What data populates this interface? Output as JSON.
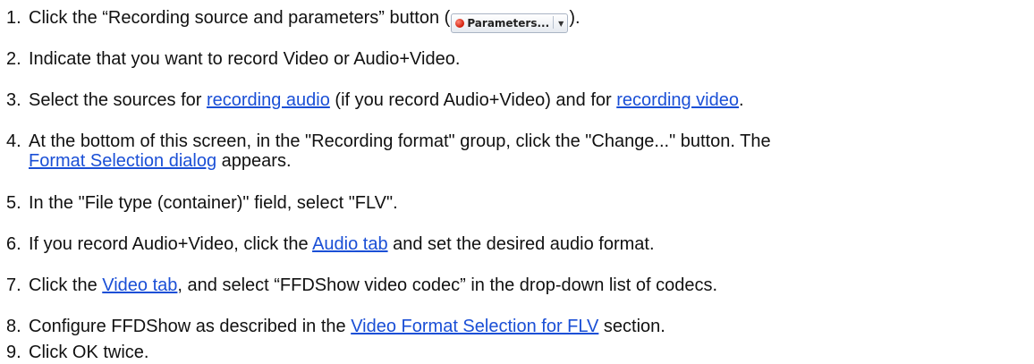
{
  "steps": [
    {
      "num": "1.",
      "a": "Click the “Recording source and parameters” button (",
      "button_label": "Parameters...",
      "b": ")."
    },
    {
      "num": "2.",
      "a": "Indicate that you want to record Video or Audio+Video."
    },
    {
      "num": "3.",
      "a": "Select the sources for ",
      "link1": "recording audio",
      "b": " (if you record Audio+Video) and for ",
      "link2": "recording video",
      "c": "."
    },
    {
      "num": "4.",
      "a": "At the bottom of this screen, in the \"Recording format\" group, click the \"Change...\" button. The",
      "link1": "Format Selection dialog",
      "b": " appears."
    },
    {
      "num": "5.",
      "a": "In the \"File type (container)\" field, select \"FLV\"."
    },
    {
      "num": "6.",
      "a": "If you record Audio+Video, click the ",
      "link1": "Audio tab",
      "b": " and set the desired audio format."
    },
    {
      "num": "7.",
      "a": "Click the ",
      "link1": "Video tab",
      "b": ", and select “FFDShow video codec” in the drop-down list of codecs."
    },
    {
      "num": "8.",
      "a": "Configure FFDShow as described in the ",
      "link1": "Video Format Selection for FLV",
      "b": " section."
    },
    {
      "num": "9.",
      "a": "Click OK twice."
    }
  ],
  "colors": {
    "link": "#1a4fd6",
    "text": "#111111",
    "record_dot": "#d01a06"
  }
}
